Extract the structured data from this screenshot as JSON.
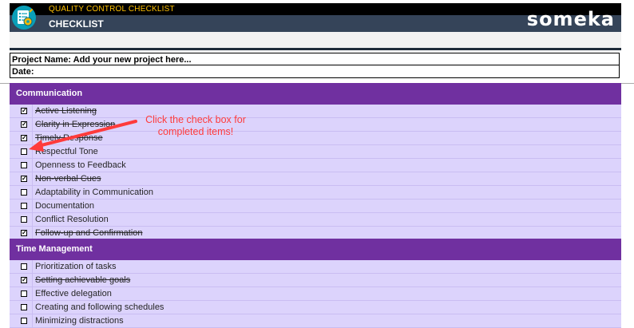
{
  "header": {
    "app_title": "QUALITY CONTROL CHECKLIST",
    "sheet_title": "CHECKLIST",
    "brand": "someka",
    "logo_icon": "checklist-gear-icon"
  },
  "info": {
    "project_name": "Project Name: Add your new project here...",
    "date": "Date:"
  },
  "sections": [
    {
      "title": "Communication",
      "items": [
        {
          "label": "Active Listening",
          "checked": true
        },
        {
          "label": "Clarity in Expression",
          "checked": true
        },
        {
          "label": "Timely Response",
          "checked": true
        },
        {
          "label": "Respectful Tone",
          "checked": false
        },
        {
          "label": "Openness to Feedback",
          "checked": false
        },
        {
          "label": "Non-verbal Cues",
          "checked": true
        },
        {
          "label": "Adaptability in Communication",
          "checked": false
        },
        {
          "label": "Documentation",
          "checked": false
        },
        {
          "label": "Conflict Resolution",
          "checked": false
        },
        {
          "label": "Follow-up and Confirmation",
          "checked": true
        }
      ]
    },
    {
      "title": "Time Management",
      "items": [
        {
          "label": "Prioritization of tasks",
          "checked": false
        },
        {
          "label": "Setting achievable goals",
          "checked": true
        },
        {
          "label": "Effective delegation",
          "checked": false
        },
        {
          "label": "Creating and following schedules",
          "checked": false
        },
        {
          "label": "Minimizing distractions",
          "checked": false
        }
      ]
    }
  ],
  "annotation": {
    "line1": "Click the check box for",
    "line2": "completed items!"
  },
  "colors": {
    "section_header": "#7030a0",
    "row_bg": "#dcd3fc",
    "annotation": "#ff3b3b",
    "banner_top": "#000000",
    "banner_bottom": "#354459",
    "app_title": "#ffc000"
  }
}
